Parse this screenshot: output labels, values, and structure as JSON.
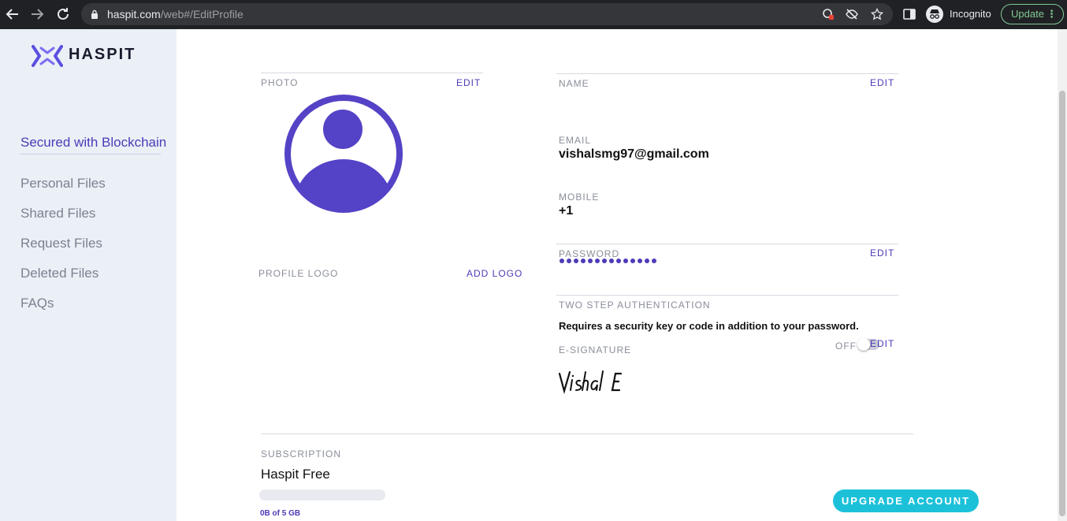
{
  "browser": {
    "url_host": "haspit.com",
    "url_path": "/web#/EditProfile",
    "profile_label": "Incognito",
    "update_label": "Update"
  },
  "sidebar": {
    "logo_text": "HASPIT",
    "tagline": "Secured with Blockchain",
    "items": [
      {
        "label": "Personal Files"
      },
      {
        "label": "Shared Files"
      },
      {
        "label": "Request Files"
      },
      {
        "label": "Deleted Files"
      },
      {
        "label": "FAQs"
      }
    ]
  },
  "profile": {
    "photo_label": "PHOTO",
    "photo_edit": "EDIT",
    "logo_label": "PROFILE LOGO",
    "add_logo": "ADD LOGO",
    "name_label": "NAME",
    "name_edit": "EDIT",
    "email_label": "EMAIL",
    "email_value": "vishalsmg97@gmail.com",
    "mobile_label": "MOBILE",
    "mobile_value": "+1",
    "password_label": "PASSWORD",
    "password_edit": "EDIT",
    "password_mask_length": 14,
    "two_step_label": "TWO STEP AUTHENTICATION",
    "two_step_desc": "Requires a security key or code in addition to your password.",
    "two_step_state": "OFF",
    "esig_label": "E-SIGNATURE",
    "esig_edit": "EDIT",
    "signature_text": "Vishal E"
  },
  "subscription": {
    "label": "SUBSCRIPTION",
    "plan": "Haspit Free",
    "usage_text": "0B of 5 GB",
    "usage_fraction": 0,
    "upgrade_label": "UPGRADE ACCOUNT"
  },
  "colors": {
    "accent": "#4c3bb8",
    "upgrade": "#1cc1d9",
    "sidebar_bg": "#eaf0f6"
  }
}
